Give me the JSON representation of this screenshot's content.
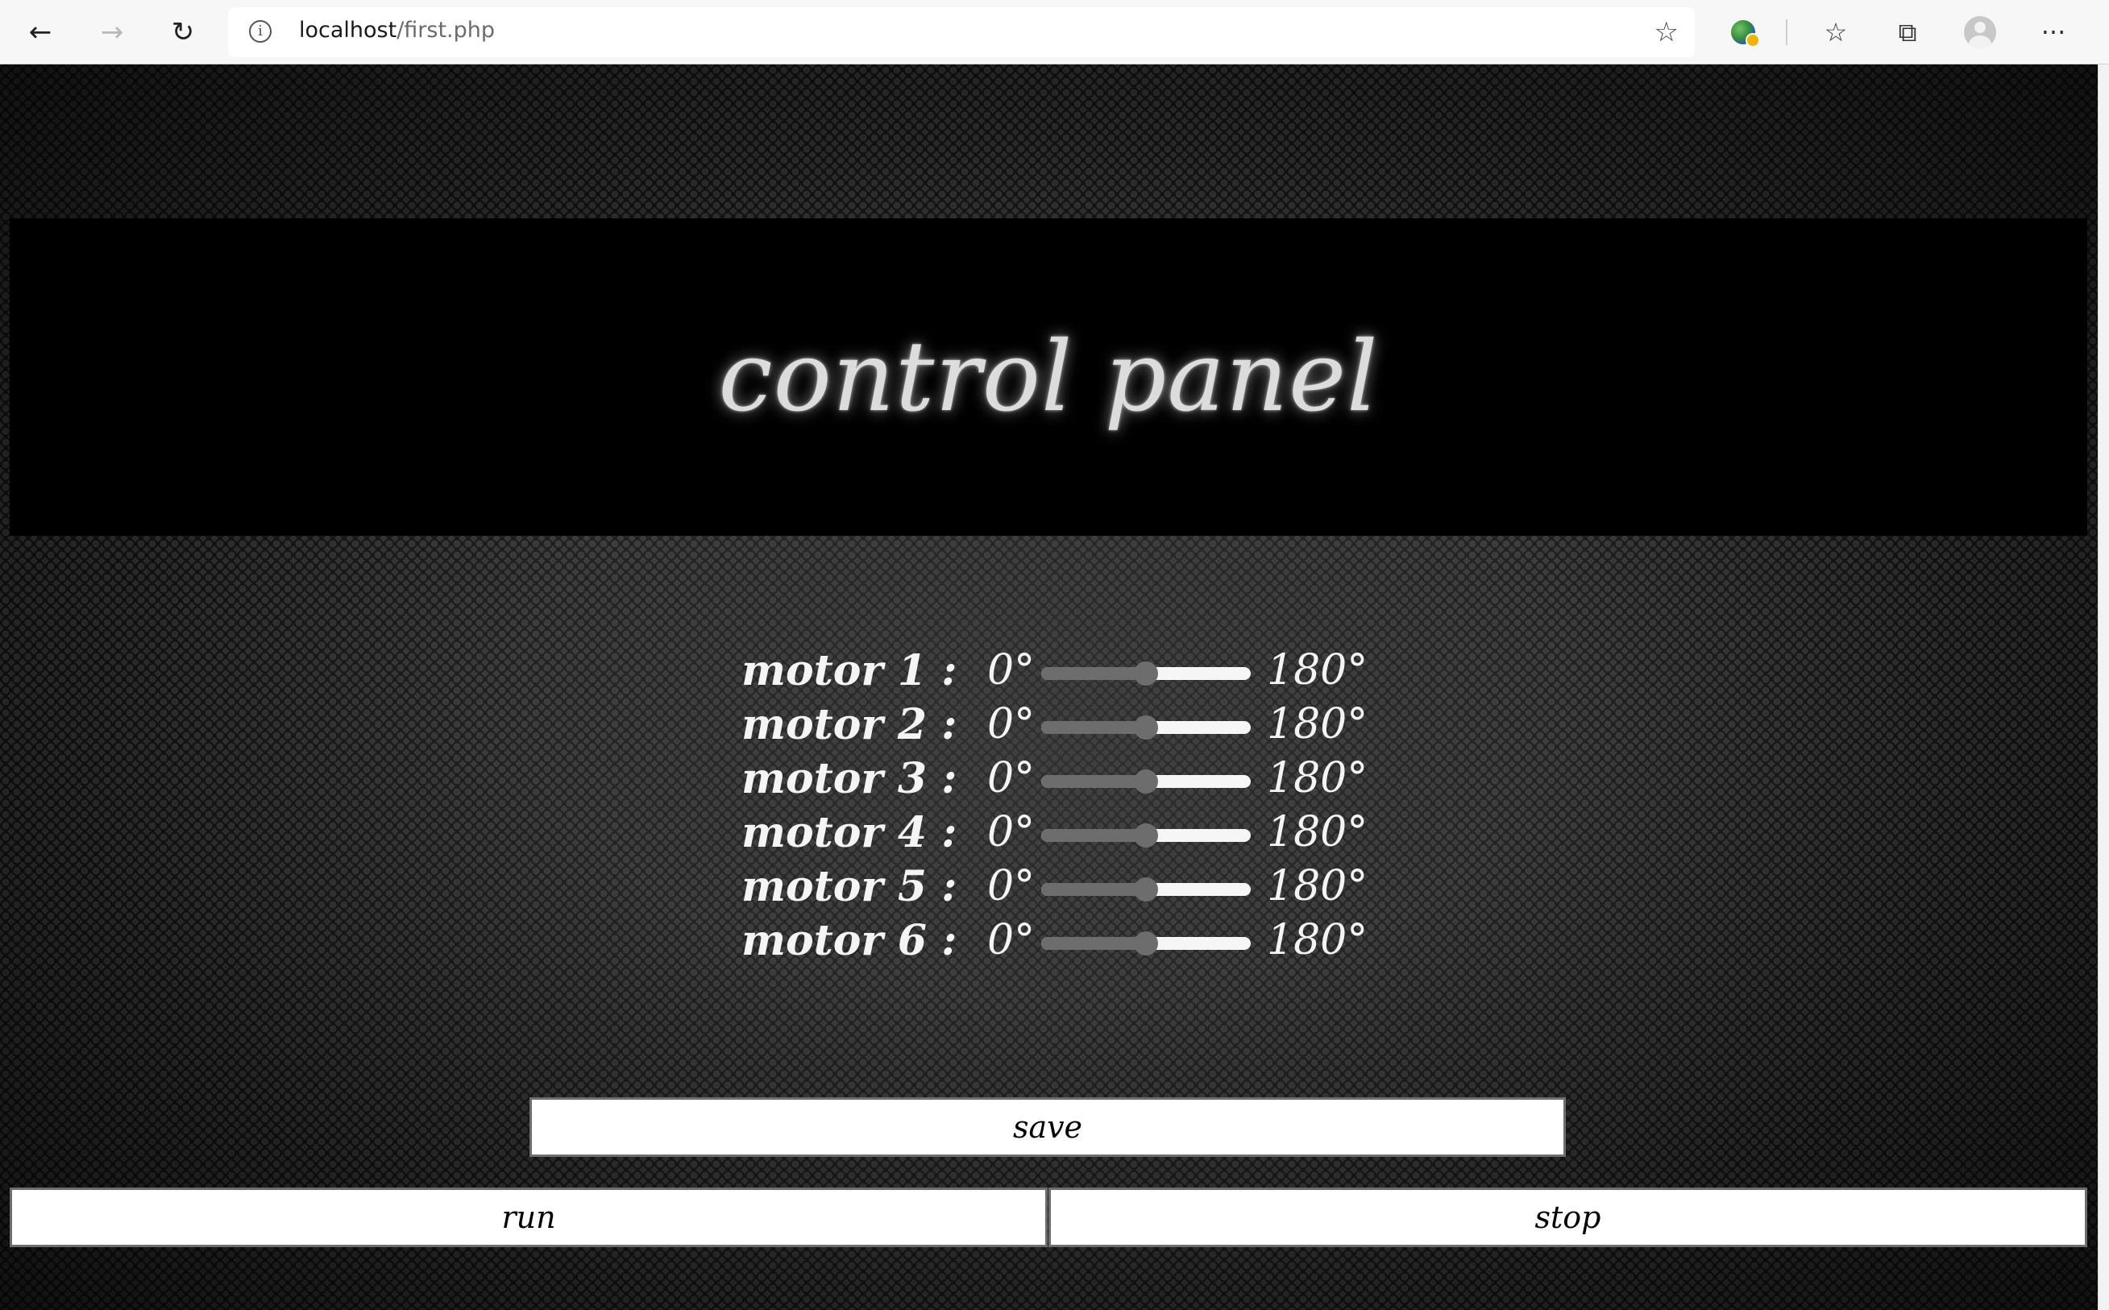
{
  "browser": {
    "url_host": "localhost",
    "url_path": "/first.php",
    "icons": {
      "back": "back-arrow-icon",
      "forward": "forward-arrow-icon",
      "refresh": "refresh-icon",
      "info": "info-icon",
      "add_favorite": "add-favorite-icon",
      "extension": "extension-icon",
      "favorites": "favorites-icon",
      "collections": "collections-icon",
      "profile": "profile-avatar-icon",
      "more": "more-menu-icon"
    }
  },
  "page": {
    "title": "control panel",
    "motors": [
      {
        "label": "motor 1 :",
        "min": "0°",
        "max": "180°",
        "value": 90
      },
      {
        "label": "motor 2 :",
        "min": "0°",
        "max": "180°",
        "value": 90
      },
      {
        "label": "motor 3 :",
        "min": "0°",
        "max": "180°",
        "value": 90
      },
      {
        "label": "motor 4 :",
        "min": "0°",
        "max": "180°",
        "value": 90
      },
      {
        "label": "motor 5 :",
        "min": "0°",
        "max": "180°",
        "value": 90
      },
      {
        "label": "motor 6 :",
        "min": "0°",
        "max": "180°",
        "value": 90
      }
    ],
    "buttons": {
      "save": "save",
      "run": "run",
      "stop": "stop"
    }
  },
  "colors": {
    "slider_filled": "#6d6d6d",
    "slider_track": "#f6f6f6",
    "title_text": "#dcdcdc",
    "header_bg": "#000000"
  }
}
